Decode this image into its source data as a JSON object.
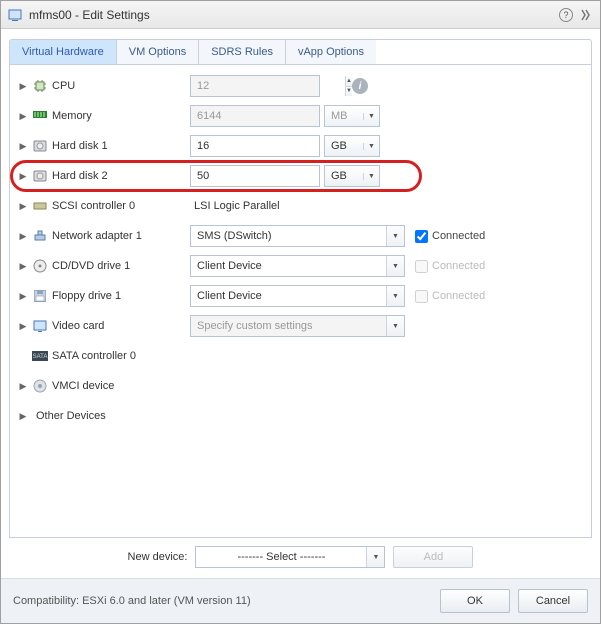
{
  "title": "mfms00 - Edit Settings",
  "tabs": [
    "Virtual Hardware",
    "VM Options",
    "SDRS Rules",
    "vApp Options"
  ],
  "rows": {
    "cpu": {
      "label": "CPU",
      "value": "12"
    },
    "memory": {
      "label": "Memory",
      "value": "6144",
      "unit": "MB"
    },
    "hdd1": {
      "label": "Hard disk 1",
      "value": "16",
      "unit": "GB"
    },
    "hdd2": {
      "label": "Hard disk 2",
      "value": "50",
      "unit": "GB"
    },
    "scsi": {
      "label": "SCSI controller 0",
      "text": "LSI Logic Parallel"
    },
    "net": {
      "label": "Network adapter 1",
      "value": "SMS (DSwitch)",
      "connected": "Connected"
    },
    "cd": {
      "label": "CD/DVD drive 1",
      "value": "Client Device",
      "connected": "Connected"
    },
    "floppy": {
      "label": "Floppy drive 1",
      "value": "Client Device",
      "connected": "Connected"
    },
    "video": {
      "label": "Video card",
      "value": "Specify custom settings"
    },
    "sata": {
      "label": "SATA controller 0"
    },
    "vmci": {
      "label": "VMCI device"
    },
    "other": {
      "label": "Other Devices"
    }
  },
  "new_device": {
    "label": "New device:",
    "select": "------- Select -------",
    "add": "Add"
  },
  "footer": {
    "compat": "Compatibility: ESXi 6.0 and later (VM version 11)",
    "ok": "OK",
    "cancel": "Cancel"
  }
}
